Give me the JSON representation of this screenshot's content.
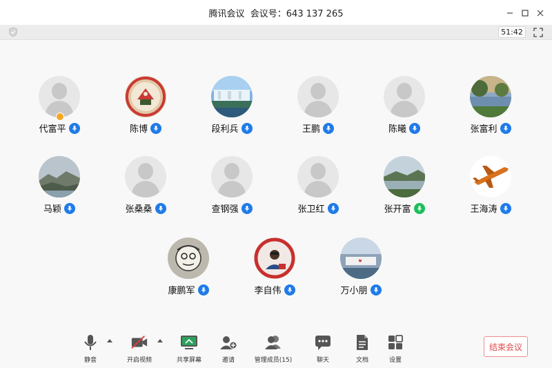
{
  "window": {
    "title": "腾讯会议  会议号：643 137 265",
    "timer": "51:42"
  },
  "participants": [
    {
      "name": "代富平",
      "host": true,
      "avatar": "default",
      "mic": "blue"
    },
    {
      "name": "陈博",
      "avatar": "red-emblem",
      "mic": "blue"
    },
    {
      "name": "段利兵",
      "avatar": "waterfall",
      "mic": "blue"
    },
    {
      "name": "王鹏",
      "avatar": "default",
      "mic": "blue"
    },
    {
      "name": "陈曦",
      "avatar": "default",
      "mic": "blue"
    },
    {
      "name": "张富利",
      "avatar": "lake-trees",
      "mic": "blue"
    },
    {
      "name": "马颖",
      "avatar": "mountains",
      "mic": "blue"
    },
    {
      "name": "张桑桑",
      "avatar": "default",
      "mic": "blue"
    },
    {
      "name": "查钢强",
      "avatar": "default",
      "mic": "blue"
    },
    {
      "name": "张卫红",
      "avatar": "default",
      "mic": "blue"
    },
    {
      "name": "张开富",
      "avatar": "river",
      "mic": "green"
    },
    {
      "name": "王海涛",
      "avatar": "airplane",
      "mic": "blue"
    },
    {
      "name": "康鹏军",
      "avatar": "sketch",
      "mic": "blue"
    },
    {
      "name": "李自伟",
      "avatar": "portrait-seal",
      "mic": "blue"
    },
    {
      "name": "万小朋",
      "avatar": "lake-sign",
      "mic": "blue"
    }
  ],
  "toolbar": {
    "mute_label": "静音",
    "video_label": "开启视频",
    "share_label": "共享屏幕",
    "invite_label": "邀请",
    "members_label": "管理成员(15)",
    "chat_label": "聊天",
    "docs_label": "文档",
    "settings_label": "设置",
    "end_label": "结束会议"
  },
  "colors": {
    "mic_blue": "#1f7be8",
    "mic_green": "#1fbd5c",
    "host_badge": "#f5a623",
    "end_button": "#e24848"
  }
}
